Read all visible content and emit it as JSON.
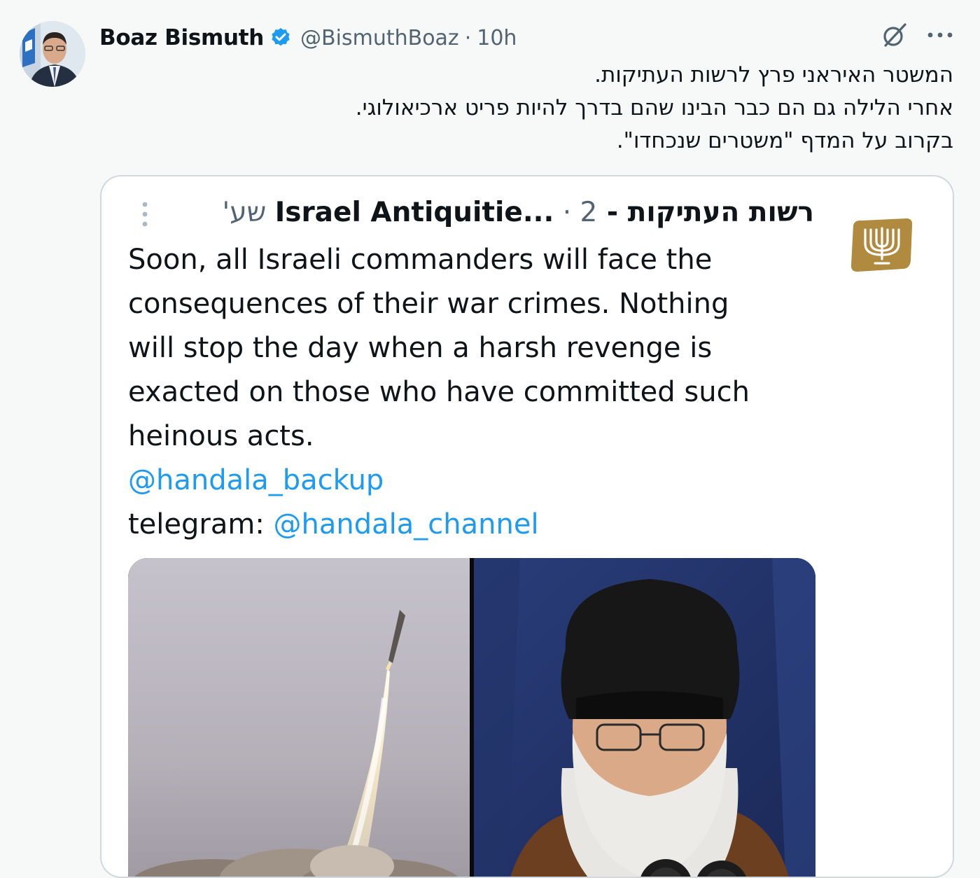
{
  "author": {
    "name": "Boaz Bismuth",
    "handle": "@BismuthBoaz",
    "separator": "·",
    "time": "10h",
    "verified": true
  },
  "actions": {
    "grok_icon": "grok-icon",
    "more_icon": "more-horizontal-icon"
  },
  "tweet": {
    "lines": [
      "המשטר האיראני פרץ לרשות העתיקות.",
      "אחרי הלילה גם הם כבר הבינו שהם בדרך להיות פריט ארכיאולוגי.",
      "בקרוב על המדף \"משטרים שנכחדו\"."
    ]
  },
  "quote": {
    "name": "רשות העתיקות - Israel Antiquitie...",
    "separator": "·",
    "time": "2 שע'",
    "body_lines": [
      "Soon, all Israeli commanders will face the",
      "consequences of their war crimes. Nothing",
      "will stop the day when a harsh revenge is",
      "exacted on those who have committed such",
      "heinous acts."
    ],
    "mention1": "@handala_backup",
    "telegram_label": "telegram: ",
    "mention2": "@handala_channel",
    "logo_icon": "menorah-logo-icon",
    "media": [
      "missile-launch-image",
      "cleric-portrait-image"
    ]
  },
  "colors": {
    "accent": "#1d9bf0",
    "text": "#0f1419",
    "secondary": "#536471",
    "border": "#cfd9de",
    "logo_gold": "#b08a3e"
  }
}
